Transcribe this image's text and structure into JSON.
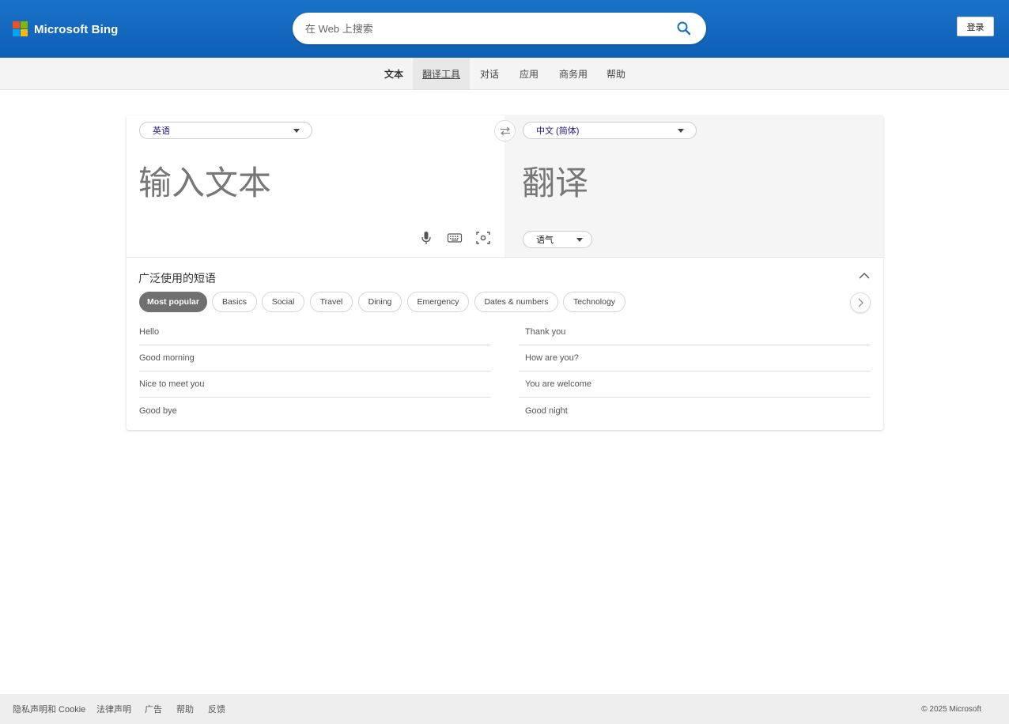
{
  "header": {
    "brand": "Microsoft Bing",
    "search_placeholder": "在 Web 上搜索",
    "signin_label": "登录",
    "logo_colors": [
      "#f25022",
      "#7fba00",
      "#00a4ef",
      "#ffb900"
    ]
  },
  "subnav": {
    "tabs": [
      {
        "label": "文本"
      },
      {
        "label": "翻译工具"
      },
      {
        "label": "对话"
      },
      {
        "label": "应用"
      },
      {
        "label": "商务用"
      },
      {
        "label": "帮助"
      }
    ]
  },
  "translator": {
    "source_lang": "英语",
    "target_lang": "中文 (简体)",
    "input_placeholder": "输入文本",
    "output_placeholder": "翻译",
    "tone_label": "语气",
    "tool_icons": [
      "microphone-icon",
      "keyboard-icon",
      "camera-scan-icon"
    ]
  },
  "phrases": {
    "title": "广泛使用的短语",
    "categories": [
      "Most popular",
      "Basics",
      "Social",
      "Travel",
      "Dining",
      "Emergency",
      "Dates & numbers",
      "Technology"
    ],
    "left": [
      "Hello",
      "Good morning",
      "Nice to meet you",
      "Good bye"
    ],
    "right": [
      "Thank you",
      "How are you?",
      "You are welcome",
      "Good night"
    ]
  },
  "footer": {
    "links": [
      "隐私声明和 Cookie",
      "法律声明",
      "广告",
      "帮助",
      "反馈"
    ],
    "copyright": "© 2025 Microsoft"
  }
}
